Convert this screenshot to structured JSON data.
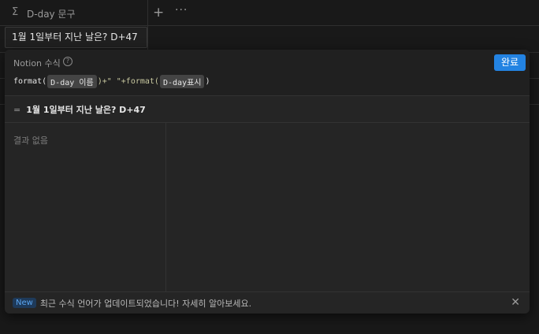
{
  "header": {
    "sigma": "Σ",
    "property_name": "D-day 문구",
    "plus": "+",
    "more": "···"
  },
  "cell": {
    "value": "1월 1일부터 지난 날은? D+47"
  },
  "panel": {
    "title": "Notion 수식",
    "help": "?",
    "done_label": "완료",
    "formula": {
      "fn1": "format(",
      "token1": "D-day 이름",
      "mid": ")+\" \"+format(",
      "token2": "D-day표시",
      "end": ")"
    },
    "result": {
      "eq": "=",
      "text": "1월 1일부터 지난 날은? D+47"
    },
    "no_results": "결과 없음",
    "footer": {
      "badge": "New",
      "message": "최근 수식 언어가 업데이트되었습니다! 자세히 알아보세요.",
      "close": "✕"
    }
  }
}
